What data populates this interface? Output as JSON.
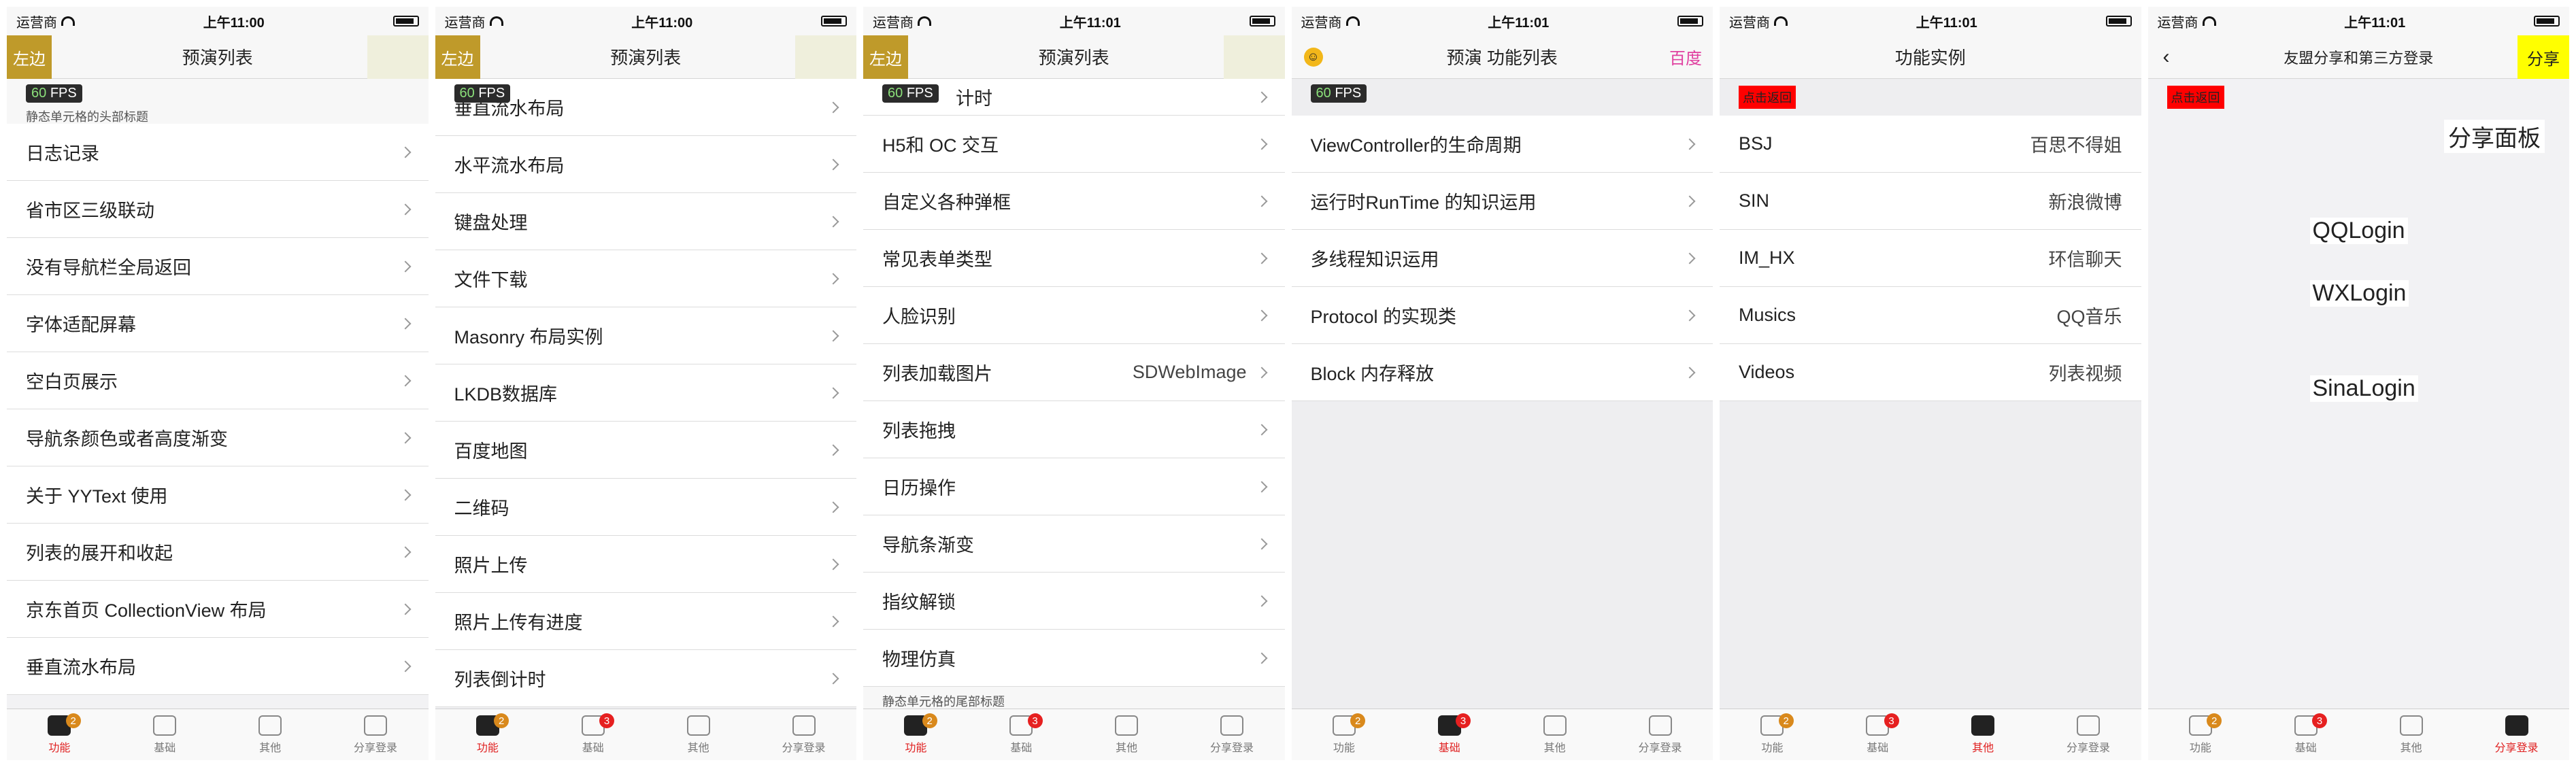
{
  "status": {
    "carrier": "运营商",
    "time_a": "上午11:00",
    "time_b": "上午11:01"
  },
  "tabs": [
    "功能",
    "基础",
    "其他",
    "分享登录"
  ],
  "badges": {
    "func": "2",
    "base": "3"
  },
  "fps": {
    "value": "60",
    "unit": "FPS"
  },
  "screen1": {
    "left_btn": "左边",
    "title": "预演列表",
    "section_head": "静态单元格的头部标题",
    "rows": [
      "日志记录",
      "省市区三级联动",
      "没有导航栏全局返回",
      "字体适配屏幕",
      "空白页展示",
      "导航条颜色或者高度渐变",
      "关于 YYText 使用",
      "列表的展开和收起",
      "京东首页 CollectionView 布局",
      "垂直流水布局"
    ]
  },
  "screen2": {
    "left_btn": "左边",
    "title": "预演列表",
    "rows": [
      "垂直流水布局",
      "水平流水布局",
      "键盘处理",
      "文件下载",
      "Masonry 布局实例",
      "LKDB数据库",
      "百度地图",
      "二维码",
      "照片上传",
      "照片上传有进度",
      "列表倒计时"
    ]
  },
  "screen3": {
    "left_btn": "左边",
    "title": "预演列表",
    "partial_top": "计时",
    "rows": [
      {
        "label": "H5和 OC 交互",
        "value": ""
      },
      {
        "label": "自定义各种弹框",
        "value": ""
      },
      {
        "label": "常见表单类型",
        "value": ""
      },
      {
        "label": "人脸识别",
        "value": ""
      },
      {
        "label": "列表加载图片",
        "value": "SDWebImage"
      },
      {
        "label": "列表拖拽",
        "value": ""
      },
      {
        "label": "日历操作",
        "value": ""
      },
      {
        "label": "导航条渐变",
        "value": ""
      },
      {
        "label": "指纹解锁",
        "value": ""
      },
      {
        "label": "物理仿真",
        "value": ""
      }
    ],
    "footer": "静态单元格的尾部标题"
  },
  "screen4": {
    "title": "预演 功能列表",
    "right_link": "百度",
    "rows": [
      "ViewController的生命周期",
      "运行时RunTime 的知识运用",
      "多线程知识运用",
      "Protocol 的实现类",
      "Block 内存释放"
    ]
  },
  "screen5": {
    "title": "功能实例",
    "back_chip": "点击返回",
    "rows": [
      {
        "label": "BSJ",
        "value": "百思不得姐"
      },
      {
        "label": "SIN",
        "value": "新浪微博"
      },
      {
        "label": "IM_HX",
        "value": "环信聊天"
      },
      {
        "label": "Musics",
        "value": "QQ音乐"
      },
      {
        "label": "Videos",
        "value": "列表视频"
      }
    ]
  },
  "screen6": {
    "title": "友盟分享和第三方登录",
    "right_btn": "分享",
    "back_chip": "点击返回",
    "share_panel": "分享面板",
    "logins": [
      "QQLogin",
      "WXLogin",
      "SinaLogin"
    ]
  },
  "colors": {
    "accent_gold": "#bf9a2a",
    "badge_red": "#e62020",
    "badge_orange": "#d9891c",
    "yellow": "#ffff00"
  }
}
